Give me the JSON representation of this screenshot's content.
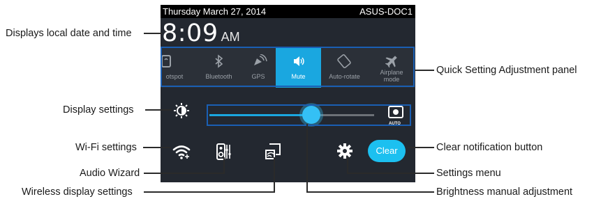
{
  "status_bar": {
    "date": "Thursday March 27, 2014",
    "device_name": "ASUS-DOC1"
  },
  "clock": {
    "time": "8:09",
    "ampm": "AM"
  },
  "quick_settings": [
    {
      "label": "otspot",
      "icon": "hotspot-icon",
      "active": false
    },
    {
      "label": "Bluetooth",
      "icon": "bluetooth-icon",
      "active": false
    },
    {
      "label": "GPS",
      "icon": "gps-icon",
      "active": false
    },
    {
      "label": "Mute",
      "icon": "mute-icon",
      "active": true
    },
    {
      "label": "Auto-rotate",
      "icon": "auto-rotate-icon",
      "active": false
    },
    {
      "label": "Airplane mode",
      "icon": "airplane-icon",
      "active": false
    }
  ],
  "brightness": {
    "auto_label": "AUTO",
    "level_fraction": 0.63
  },
  "bottom_bar": {
    "clear_label": "Clear"
  },
  "annotations": {
    "date_time": "Displays local date and time",
    "quick_panel": "Quick Setting Adjustment panel",
    "display_settings": "Display settings",
    "wifi_settings": "Wi-Fi settings",
    "clear_button": "Clear notification button",
    "audio_wizard": "Audio Wizard",
    "settings_menu": "Settings menu",
    "wireless_display": "Wireless display settings",
    "brightness_manual": "Brightness manual adjustment"
  },
  "colors": {
    "accent": "#1aa7e0",
    "panel_bg": "#232830",
    "callout_frame": "#1a5fb4"
  }
}
